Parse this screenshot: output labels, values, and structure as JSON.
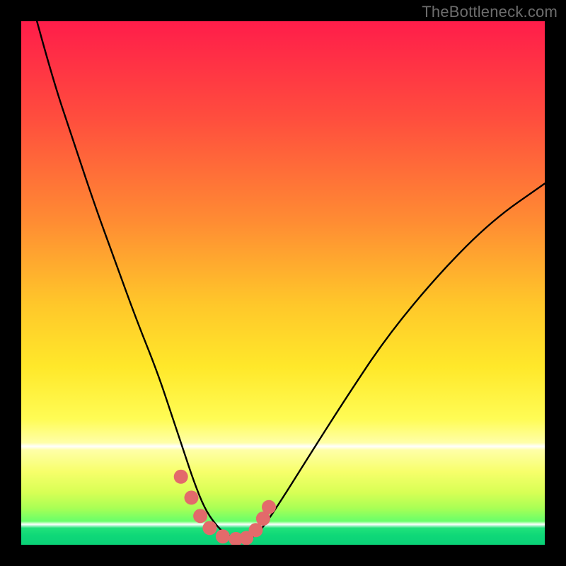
{
  "watermark": "TheBottleneck.com",
  "colors": {
    "frame": "#000000",
    "curve": "#000000",
    "marker_fill": "#e36a6b",
    "marker_stroke": "#8a2f34",
    "gradient_stops": [
      "#ff1d4a",
      "#ff8b33",
      "#ffe82a",
      "#ffffa8",
      "#0ad177"
    ]
  },
  "chart_data": {
    "type": "line",
    "title": "",
    "xlabel": "",
    "ylabel": "",
    "xlim": [
      0,
      100
    ],
    "ylim": [
      0,
      100
    ],
    "grid": false,
    "legend": false,
    "series": [
      {
        "name": "bottleneck-curve",
        "x": [
          3,
          6,
          10,
          14,
          18,
          22,
          26,
          29,
          31,
          33,
          35,
          37,
          39,
          41,
          43,
          44,
          46,
          50,
          55,
          62,
          70,
          80,
          90,
          100
        ],
        "y": [
          100,
          89,
          77,
          65,
          54,
          43,
          33,
          24,
          18,
          12,
          7,
          4,
          2,
          1.2,
          1,
          1.3,
          3,
          9,
          17,
          28,
          40,
          52,
          62,
          69
        ]
      }
    ],
    "markers": {
      "name": "highlighted-points",
      "x": [
        30.5,
        32.5,
        34.2,
        36.0,
        38.5,
        41.0,
        43.0,
        44.8,
        46.2,
        47.3
      ],
      "y": [
        13.0,
        9.0,
        5.5,
        3.2,
        1.6,
        1.1,
        1.3,
        2.8,
        5.0,
        7.2
      ]
    }
  }
}
